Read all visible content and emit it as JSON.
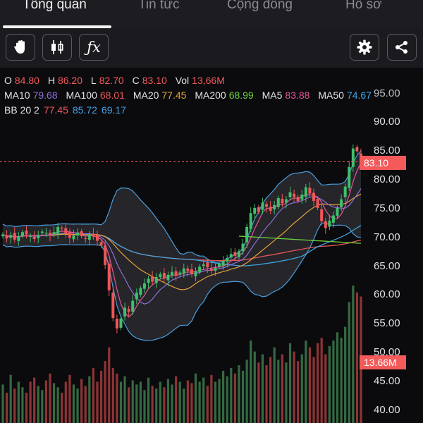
{
  "tabs": [
    {
      "label": "Tổng quan",
      "active": true
    },
    {
      "label": "Tin tức",
      "active": false
    },
    {
      "label": "Cộng đồng",
      "active": false
    },
    {
      "label": "Hồ sơ",
      "active": false
    }
  ],
  "toolbar": {
    "left_icons": [
      "hand-pointer-icon",
      "candlestick-icon",
      "function-fx-icon"
    ],
    "right_icons": [
      "gear-icon",
      "share-icon"
    ],
    "fx_text": "ƒx"
  },
  "legend": {
    "ohlc": {
      "o_label": "O",
      "o_value": "84.80",
      "h_label": "H",
      "h_value": "86.20",
      "l_label": "L",
      "l_value": "82.70",
      "c_label": "C",
      "c_value": "83.10",
      "vol_label": "Vol",
      "vol_value": "13,66M"
    },
    "ma_row": [
      {
        "label": "MA10",
        "value": "79.68",
        "color": "#8e6fd6"
      },
      {
        "label": "MA100",
        "value": "68.01",
        "color": "#e55555"
      },
      {
        "label": "MA20",
        "value": "77.45",
        "color": "#e8a23b"
      },
      {
        "label": "MA200",
        "value": "68.99",
        "color": "#6ccf3d"
      },
      {
        "label": "MA5",
        "value": "83.88",
        "color": "#e2559a"
      },
      {
        "label": "MA50",
        "value": "74.67",
        "color": "#3fa9e8"
      }
    ],
    "bb": {
      "label": "BB 20 2",
      "upper": "77.45",
      "middle": "85.72",
      "lower": "69.17",
      "upper_color": "#f45a5a",
      "middle_color": "#4aa0e0",
      "lower_color": "#4aa0e0"
    }
  },
  "chart_data": {
    "type": "candlestick",
    "y_ticks": [
      "90.00",
      "85.00",
      "80.00",
      "75.00",
      "70.00",
      "65.00",
      "60.00",
      "55.00",
      "50.00",
      "45.00",
      "40.00"
    ],
    "y_tick_top_partial": "95.00",
    "ylim": [
      38,
      96
    ],
    "last_price": "83.10",
    "last_volume_tag": "13.66M",
    "closes": [
      70.5,
      69.8,
      70.4,
      69.6,
      70.2,
      70.9,
      70.5,
      70.2,
      69.7,
      70.4,
      71.0,
      70.8,
      70.3,
      70.9,
      71.8,
      71.5,
      70.6,
      69.9,
      70.3,
      70.8,
      70.2,
      69.7,
      70.5,
      70.1,
      69.4,
      68.6,
      65.2,
      60.8,
      56.0,
      54.2,
      55.9,
      57.8,
      57.1,
      59.0,
      60.4,
      61.2,
      62.0,
      62.8,
      62.3,
      63.1,
      63.6,
      62.9,
      63.5,
      64.0,
      63.3,
      63.9,
      64.6,
      64.2,
      63.6,
      64.1,
      64.9,
      65.3,
      64.8,
      64.2,
      64.7,
      65.4,
      65.9,
      66.4,
      67.1,
      66.8,
      67.6,
      68.9,
      71.8,
      74.2,
      75.1,
      74.4,
      76.0,
      75.3,
      74.6,
      75.6,
      76.8,
      75.9,
      76.6,
      77.8,
      77.0,
      76.3,
      77.4,
      78.7,
      77.6,
      76.3,
      75.1,
      72.8,
      71.6,
      72.9,
      73.8,
      75.1,
      76.6,
      78.8,
      82.2,
      85.4,
      84.9,
      83.1
    ],
    "volumes": [
      0.28,
      0.22,
      0.35,
      0.25,
      0.3,
      0.26,
      0.22,
      0.3,
      0.33,
      0.27,
      0.24,
      0.31,
      0.36,
      0.29,
      0.26,
      0.22,
      0.3,
      0.35,
      0.28,
      0.25,
      0.32,
      0.27,
      0.34,
      0.4,
      0.3,
      0.38,
      0.45,
      0.55,
      0.4,
      0.36,
      0.3,
      0.34,
      0.26,
      0.31,
      0.28,
      0.3,
      0.24,
      0.33,
      0.27,
      0.25,
      0.3,
      0.26,
      0.32,
      0.28,
      0.34,
      0.3,
      0.25,
      0.31,
      0.29,
      0.36,
      0.3,
      0.33,
      0.27,
      0.35,
      0.3,
      0.32,
      0.38,
      0.34,
      0.4,
      0.36,
      0.42,
      0.38,
      0.46,
      0.6,
      0.52,
      0.44,
      0.5,
      0.42,
      0.48,
      0.55,
      0.46,
      0.5,
      0.44,
      0.58,
      0.52,
      0.45,
      0.5,
      0.6,
      0.55,
      0.48,
      0.58,
      0.62,
      0.5,
      0.56,
      0.6,
      0.66,
      0.62,
      0.7,
      0.88,
      1.0,
      0.95,
      0.92
    ]
  }
}
